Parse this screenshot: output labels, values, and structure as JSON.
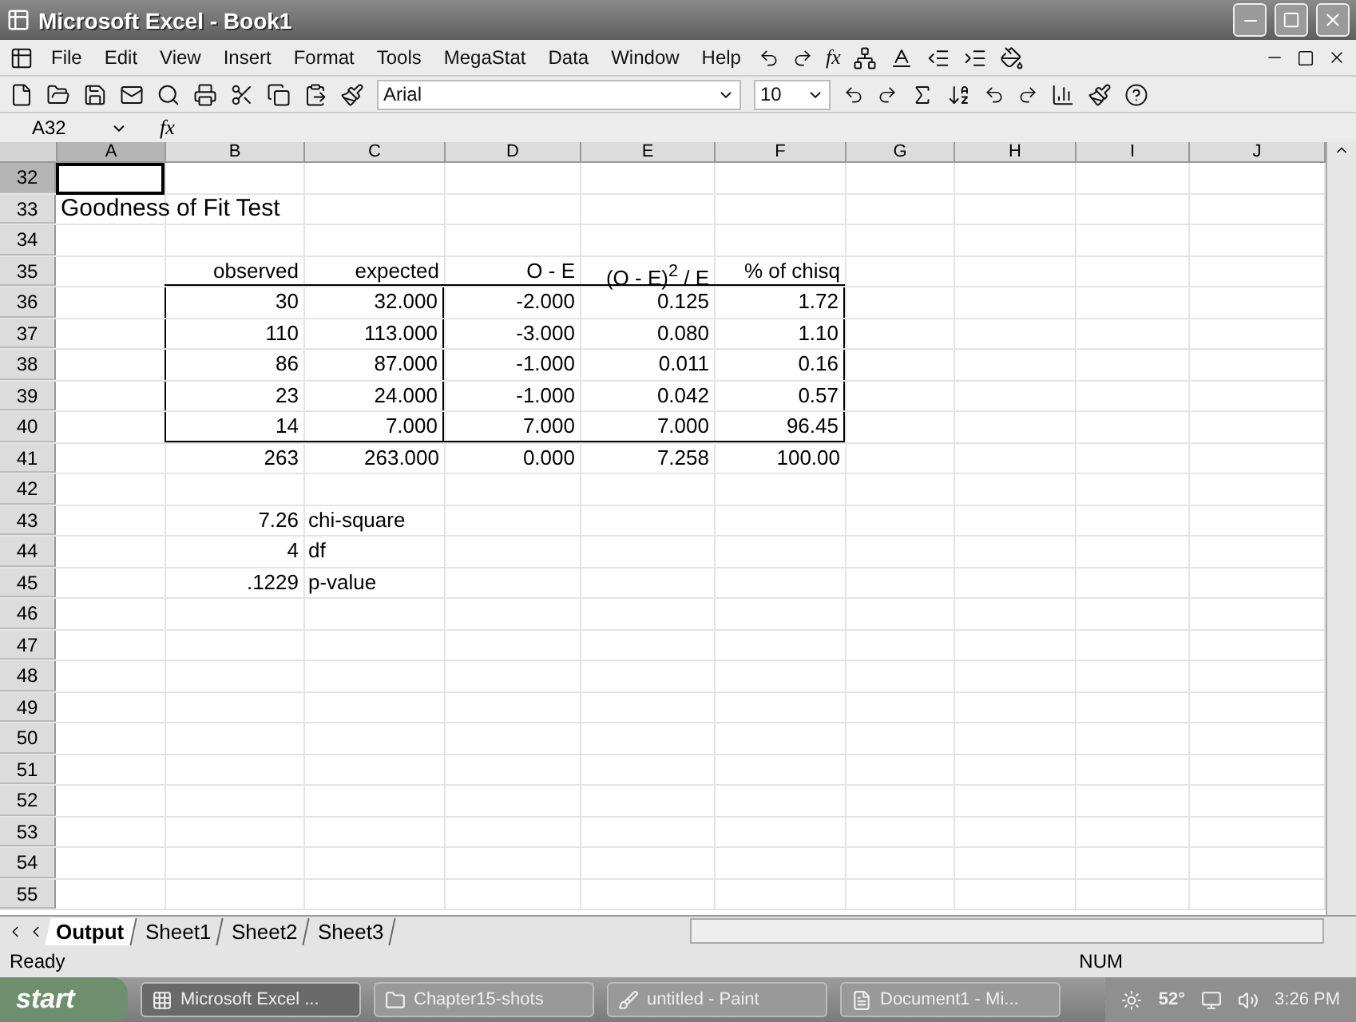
{
  "window": {
    "title": "Microsoft Excel - Book1"
  },
  "menu": [
    "File",
    "Edit",
    "View",
    "Insert",
    "Format",
    "Tools",
    "MegaStat",
    "Data",
    "Window",
    "Help"
  ],
  "menu_fx": "fx",
  "formatting": {
    "font": "Arial",
    "size": "10"
  },
  "formula_bar": {
    "name_box": "A32",
    "fx_label": "fx"
  },
  "columns": [
    {
      "label": "A",
      "selected": true
    },
    {
      "label": "B",
      "selected": false
    },
    {
      "label": "C",
      "selected": false
    },
    {
      "label": "D",
      "selected": false
    },
    {
      "label": "E",
      "selected": false
    },
    {
      "label": "F",
      "selected": false
    },
    {
      "label": "G",
      "selected": false
    },
    {
      "label": "H",
      "selected": false
    },
    {
      "label": "I",
      "selected": false
    },
    {
      "label": "J",
      "selected": false
    }
  ],
  "rows": [
    {
      "number": "32",
      "selected": true,
      "boxed": false,
      "cells": {}
    },
    {
      "number": "33",
      "selected": false,
      "boxed": false,
      "cells": {
        "col_a": {
          "text": "Goodness of Fit Test",
          "kind": "title"
        }
      }
    },
    {
      "number": "34",
      "selected": false,
      "boxed": false,
      "cells": {}
    },
    {
      "number": "35",
      "selected": false,
      "boxed": false,
      "cells": {
        "col_b": {
          "text": "observed",
          "kind": "number"
        },
        "col_c": {
          "text": "expected",
          "kind": "number"
        },
        "col_d": {
          "text": "O - E",
          "kind": "number"
        },
        "col_e": {
          "text": "(O - E)$^{2}$ / E",
          "kind": "number"
        },
        "col_f": {
          "text": "% of chisq",
          "kind": "number"
        }
      }
    },
    {
      "number": "36",
      "selected": false,
      "boxed": true,
      "cells": {
        "col_b": {
          "text": "30",
          "kind": "number"
        },
        "col_c": {
          "text": "32.000",
          "kind": "number"
        },
        "col_d": {
          "text": "-2.000",
          "kind": "number"
        },
        "col_e": {
          "text": "0.125",
          "kind": "number"
        },
        "col_f": {
          "text": "1.72",
          "kind": "number"
        }
      }
    },
    {
      "number": "37",
      "selected": false,
      "boxed": true,
      "cells": {
        "col_b": {
          "text": "110",
          "kind": "number"
        },
        "col_c": {
          "text": "113.000",
          "kind": "number"
        },
        "col_d": {
          "text": "-3.000",
          "kind": "number"
        },
        "col_e": {
          "text": "0.080",
          "kind": "number"
        },
        "col_f": {
          "text": "1.10",
          "kind": "number"
        }
      }
    },
    {
      "number": "38",
      "selected": false,
      "boxed": true,
      "cells": {
        "col_b": {
          "text": "86",
          "kind": "number"
        },
        "col_c": {
          "text": "87.000",
          "kind": "number"
        },
        "col_d": {
          "text": "-1.000",
          "kind": "number"
        },
        "col_e": {
          "text": "0.011",
          "kind": "number"
        },
        "col_f": {
          "text": "0.16",
          "kind": "number"
        }
      }
    },
    {
      "number": "39",
      "selected": false,
      "boxed": true,
      "cells": {
        "col_b": {
          "text": "23",
          "kind": "number"
        },
        "col_c": {
          "text": "24.000",
          "kind": "number"
        },
        "col_d": {
          "text": "-1.000",
          "kind": "number"
        },
        "col_e": {
          "text": "0.042",
          "kind": "number"
        },
        "col_f": {
          "text": "0.57",
          "kind": "number"
        }
      }
    },
    {
      "number": "40",
      "selected": false,
      "boxed": true,
      "cells": {
        "col_b": {
          "text": "14",
          "kind": "number"
        },
        "col_c": {
          "text": "7.000",
          "kind": "number"
        },
        "col_d": {
          "text": "7.000",
          "kind": "number"
        },
        "col_e": {
          "text": "7.000",
          "kind": "number"
        },
        "col_f": {
          "text": "96.45",
          "kind": "number"
        }
      }
    },
    {
      "number": "41",
      "selected": false,
      "boxed": false,
      "cells": {
        "col_b": {
          "text": "263",
          "kind": "number"
        },
        "col_c": {
          "text": "263.000",
          "kind": "number"
        },
        "col_d": {
          "text": "0.000",
          "kind": "number"
        },
        "col_e": {
          "text": "7.258",
          "kind": "number"
        },
        "col_f": {
          "text": "100.00",
          "kind": "number"
        }
      }
    },
    {
      "number": "42",
      "selected": false,
      "boxed": false,
      "cells": {}
    },
    {
      "number": "43",
      "selected": false,
      "boxed": false,
      "cells": {
        "col_b": {
          "text": "7.26",
          "kind": "number"
        },
        "col_c": {
          "text": "chi-square",
          "kind": "label"
        }
      }
    },
    {
      "number": "44",
      "selected": false,
      "boxed": false,
      "cells": {
        "col_b": {
          "text": "4",
          "kind": "number"
        },
        "col_c": {
          "text": "df",
          "kind": "label"
        }
      }
    },
    {
      "number": "45",
      "selected": false,
      "boxed": false,
      "cells": {
        "col_b": {
          "text": ".1229",
          "kind": "number"
        },
        "col_c": {
          "text": "p-value",
          "kind": "label"
        }
      }
    },
    {
      "number": "46",
      "selected": false,
      "boxed": false,
      "cells": {}
    },
    {
      "number": "47",
      "selected": false,
      "boxed": false,
      "cells": {}
    },
    {
      "number": "48",
      "selected": false,
      "boxed": false,
      "cells": {}
    },
    {
      "number": "49",
      "selected": false,
      "boxed": false,
      "cells": {}
    },
    {
      "number": "50",
      "selected": false,
      "boxed": false,
      "cells": {}
    },
    {
      "number": "51",
      "selected": false,
      "boxed": false,
      "cells": {}
    },
    {
      "number": "52",
      "selected": false,
      "boxed": false,
      "cells": {}
    },
    {
      "number": "53",
      "selected": false,
      "boxed": false,
      "cells": {}
    },
    {
      "number": "54",
      "selected": false,
      "boxed": false,
      "cells": {}
    },
    {
      "number": "55",
      "selected": false,
      "boxed": false,
      "cells": {}
    }
  ],
  "sheet_tabs": [
    {
      "label": "Output",
      "selected": true
    },
    {
      "label": "Sheet1",
      "selected": false
    },
    {
      "label": "Sheet2",
      "selected": false
    },
    {
      "label": "Sheet3",
      "selected": false
    }
  ],
  "status_bar": {
    "state": "Ready",
    "indicator": "NUM"
  },
  "taskbar": {
    "start": "start",
    "buttons": [
      {
        "label": "Microsoft Excel ...",
        "kind": "excel",
        "selected": true
      },
      {
        "label": "Chapter15-shots",
        "kind": "folder",
        "selected": false
      },
      {
        "label": "untitled - Paint",
        "kind": "paint",
        "selected": false
      },
      {
        "label": "Document1 - Mi...",
        "kind": "word",
        "selected": false
      }
    ],
    "weather": "52°",
    "clock": "3:26 PM"
  }
}
